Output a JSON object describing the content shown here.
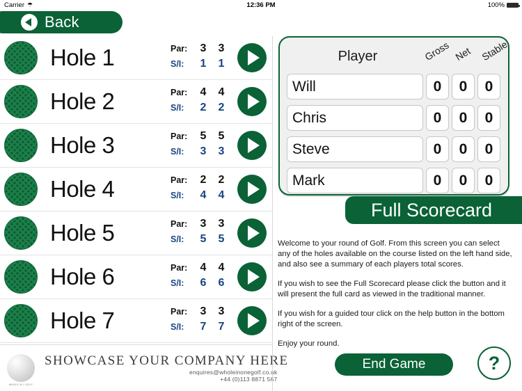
{
  "status_bar": {
    "carrier": "Carrier",
    "wifi_icon": "wifi-icon",
    "time": "12:36 PM",
    "battery_percent": "100%"
  },
  "nav": {
    "back_label": "Back",
    "back_icon": "chevron-left-circle-icon"
  },
  "theme": {
    "green": "#0a6236",
    "ball_green": "#1a8049",
    "si_blue": "#16457e",
    "panel_bg": "#f0f0f0"
  },
  "hole_list": {
    "par_label": "Par:",
    "si_label": "S/I:",
    "holes": [
      {
        "name": "Hole 1",
        "par": [
          "3",
          "3"
        ],
        "si": [
          "1",
          "1"
        ]
      },
      {
        "name": "Hole 2",
        "par": [
          "4",
          "4"
        ],
        "si": [
          "2",
          "2"
        ]
      },
      {
        "name": "Hole 3",
        "par": [
          "5",
          "5"
        ],
        "si": [
          "3",
          "3"
        ]
      },
      {
        "name": "Hole 4",
        "par": [
          "2",
          "2"
        ],
        "si": [
          "4",
          "4"
        ]
      },
      {
        "name": "Hole 5",
        "par": [
          "3",
          "3"
        ],
        "si": [
          "5",
          "5"
        ]
      },
      {
        "name": "Hole 6",
        "par": [
          "4",
          "4"
        ],
        "si": [
          "6",
          "6"
        ]
      },
      {
        "name": "Hole 7",
        "par": [
          "3",
          "3"
        ],
        "si": [
          "7",
          "7"
        ]
      }
    ]
  },
  "sponsor": {
    "title": "SHOWCASE YOUR COMPANY HERE",
    "email": "enquires@wholeinonegolf.co.uk",
    "phone": "+44 (0)113 8871 567",
    "logo_caption": "WHOLE IN 1 GOLF"
  },
  "scorecard": {
    "header_player": "Player",
    "header_gross": "Gross",
    "header_net": "Net",
    "header_stable": "Stable",
    "players": [
      {
        "name": "Will",
        "gross": "0",
        "net": "0",
        "stable": "0"
      },
      {
        "name": "Chris",
        "gross": "0",
        "net": "0",
        "stable": "0"
      },
      {
        "name": "Steve",
        "gross": "0",
        "net": "0",
        "stable": "0"
      },
      {
        "name": "Mark",
        "gross": "0",
        "net": "0",
        "stable": "0"
      }
    ],
    "full_scorecard_label": "Full Scorecard"
  },
  "info": {
    "p1": "Welcome to your round of Golf. From this screen you can select any of the holes available on the course listed on the left hand side, and also see a summary of each players total scores.",
    "p2": "If you wish to see the Full Scorecard please click the button and it will present the full card as viewed in the traditional manner.",
    "p3": "If you wish for a guided tour click on the help button in the bottom right of the screen.",
    "p4": "Enjoy your round."
  },
  "actions": {
    "end_game_label": "End Game",
    "help_label": "?"
  }
}
